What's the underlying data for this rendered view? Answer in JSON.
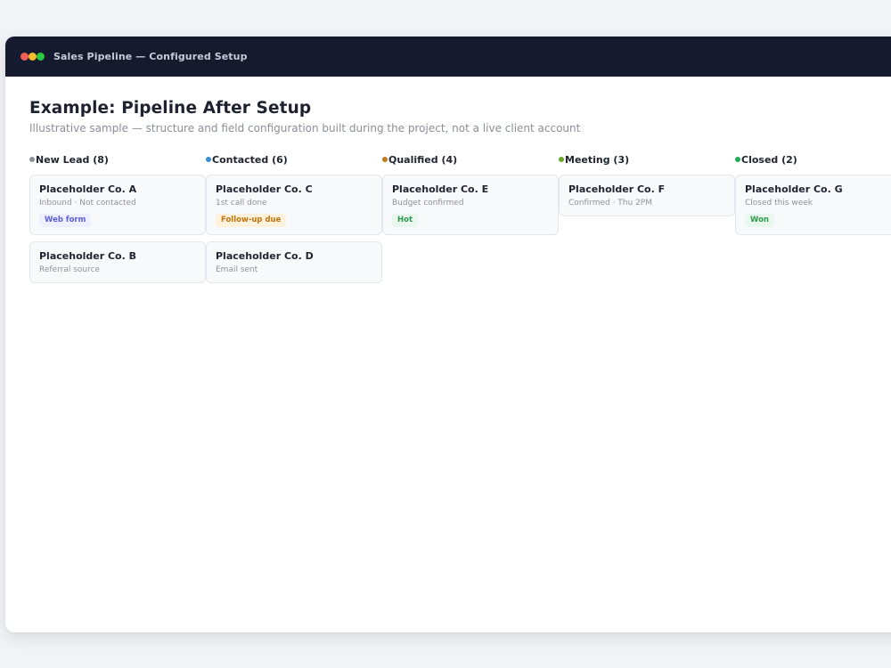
{
  "window": {
    "title": "Sales Pipeline — Configured Setup",
    "controls": [
      {
        "name": "close",
        "color": "#f05f57"
      },
      {
        "name": "minimize",
        "color": "#f7bb2f"
      },
      {
        "name": "maximize",
        "color": "#2bc841"
      }
    ]
  },
  "header": {
    "title": "Example: Pipeline After Setup",
    "subtitle": "Illustrative sample — structure and field configuration built during the project, not a live client account"
  },
  "columns": [
    {
      "label": "New Lead (8)",
      "dot_color": "#8a8f9c",
      "cards": [
        {
          "name": "Placeholder Co. A",
          "sub": "Inbound · Not contacted",
          "tag": {
            "label": "Web form",
            "fg": "#5b5fd6",
            "bg": "#eef0ff"
          }
        },
        {
          "name": "Placeholder Co. B",
          "sub": "Referral source"
        }
      ]
    },
    {
      "label": "Contacted (6)",
      "dot_color": "#3b8fd6",
      "cards": [
        {
          "name": "Placeholder Co. C",
          "sub": "1st call done",
          "tag": {
            "label": "Follow-up due",
            "fg": "#c4740f",
            "bg": "#fff2dc"
          }
        },
        {
          "name": "Placeholder Co. D",
          "sub": "Email sent"
        }
      ]
    },
    {
      "label": "Qualified (4)",
      "dot_color": "#c07a1a",
      "cards": [
        {
          "name": "Placeholder Co. E",
          "sub": "Budget confirmed",
          "tag": {
            "label": "Hot",
            "fg": "#2a9b4b",
            "bg": "#eaf7ee"
          }
        }
      ]
    },
    {
      "label": "Meeting (3)",
      "dot_color": "#6aa82a",
      "cards": [
        {
          "name": "Placeholder Co. F",
          "sub": "Confirmed · Thu 2PM"
        }
      ]
    },
    {
      "label": "Closed (2)",
      "dot_color": "#1fae5b",
      "cards": [
        {
          "name": "Placeholder Co. G",
          "sub": "Closed this week",
          "tag": {
            "label": "Won",
            "fg": "#2a9b4b",
            "bg": "#eaf7ee"
          }
        }
      ]
    }
  ]
}
